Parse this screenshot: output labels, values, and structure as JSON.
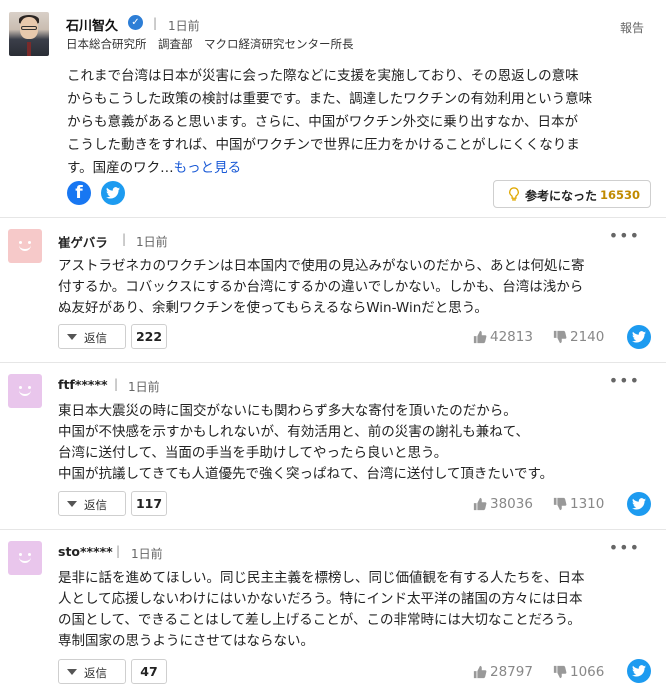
{
  "expert": {
    "name": "石川智久",
    "time": "1日前",
    "separator": "|",
    "title": "日本総合研究所　調査部　マクロ経済研究センター所長",
    "report_label": "報告",
    "body_lines": [
      "これまで台湾は日本が災害に会った際などに支援を実施しており、その恩返しの意味",
      "からもこうした政策の検討は重要です。また、調達したワクチンの有効利用という意味",
      "からも意義があると思います。さらに、中国がワクチン外交に乗り出すなか、日本が",
      "こうした動きをすれば、中国がワクチンで世界に圧力をかけることがしにくくなりま"
    ],
    "body_last": "す。国産のワク…",
    "more_label": "もっと見る",
    "helpful_label": "参考になった",
    "helpful_count": "16530"
  },
  "comments": [
    {
      "name": "崔ゲバラ",
      "time": "1日前",
      "avatar_color": "#f6c9c9",
      "lines": [
        "アストラゼネカのワクチンは日本国内で使用の見込みがないのだから、あとは何処に寄",
        "付するか。コバックスにするか台湾にするかの違いでしかない。しかも、台湾は浅から",
        "ぬ友好があり、余剰ワクチンを使ってもらえるならWin-Winだと思う。"
      ],
      "reply_label": "返信",
      "reply_count": "222",
      "likes": "42813",
      "dislikes": "2140"
    },
    {
      "name": "ftf*****",
      "time": "1日前",
      "avatar_color": "#e9c6ec",
      "lines": [
        "東日本大震災の時に国交がないにも関わらず多大な寄付を頂いたのだから。",
        "中国が不快感を示すかもしれないが、有効活用と、前の災害の謝礼も兼ねて、",
        "台湾に送付して、当面の手当を手助けしてやったら良いと思う。",
        "中国が抗議してきても人道優先で強く突っぱねて、台湾に送付して頂きたいです。"
      ],
      "reply_label": "返信",
      "reply_count": "117",
      "likes": "38036",
      "dislikes": "1310"
    },
    {
      "name": "sto*****",
      "time": "1日前",
      "avatar_color": "#e9c6ec",
      "lines": [
        "是非に話を進めてほしい。同じ民主主義を標榜し、同じ価値観を有する人たちを、日本",
        "人として応援しないわけにはいかないだろう。特にインド太平洋の諸国の方々には日本",
        "の国として、できることはして差し上げることが、この非常時には大切なことだろう。",
        "専制国家の思うようにさせてはならない。"
      ],
      "reply_label": "返信",
      "reply_count": "47",
      "likes": "28797",
      "dislikes": "1066"
    }
  ],
  "colors": {
    "link": "#1a5ad6",
    "helpful_count": "#c08a00",
    "facebook": "#1877f2",
    "twitter": "#1d9bf0"
  }
}
